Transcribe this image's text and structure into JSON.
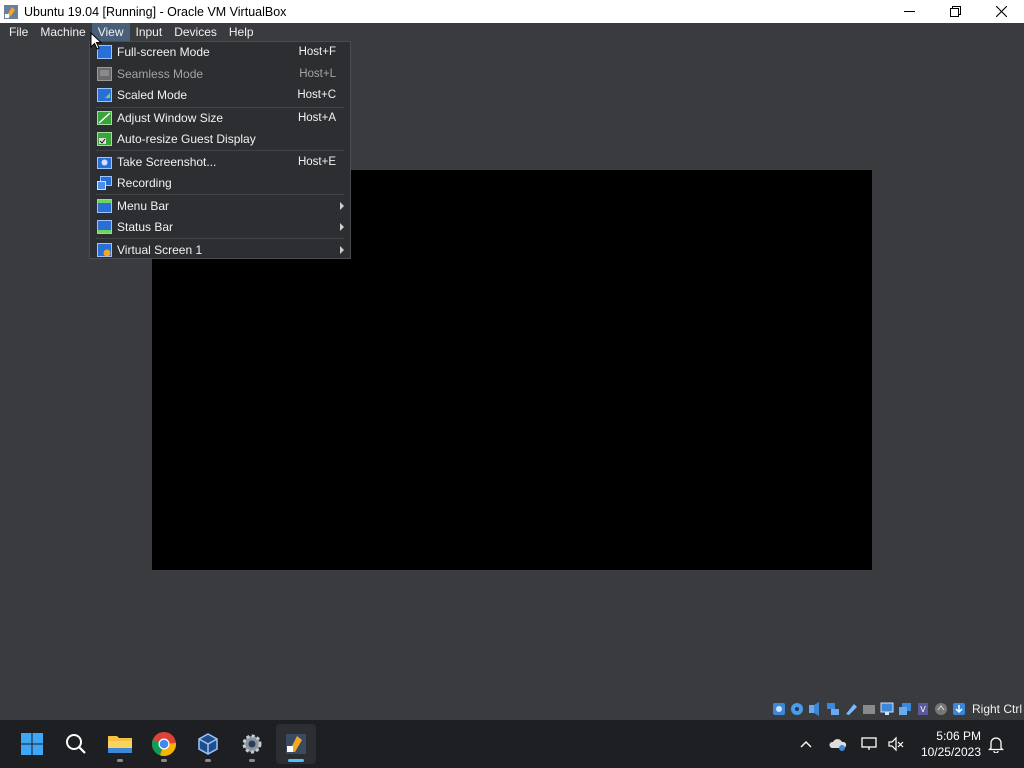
{
  "window": {
    "title": "Ubuntu 19.04 [Running] - Oracle VM VirtualBox",
    "controls": [
      "minimize-icon",
      "maximize-icon",
      "close-icon"
    ]
  },
  "menubar": {
    "items": [
      {
        "label": "File"
      },
      {
        "label": "Machine"
      },
      {
        "label": "View",
        "active": true
      },
      {
        "label": "Input"
      },
      {
        "label": "Devices"
      },
      {
        "label": "Help"
      }
    ]
  },
  "view_menu": {
    "items": [
      {
        "label": "Full-screen Mode",
        "shortcut": "Host+F",
        "icon": "fullscreen-icon"
      },
      {
        "label": "Seamless Mode",
        "shortcut": "Host+L",
        "icon": "seamless-icon",
        "disabled": true
      },
      {
        "label": "Scaled Mode",
        "shortcut": "Host+C",
        "icon": "scaled-icon"
      },
      {
        "label": "Adjust Window Size",
        "shortcut": "Host+A",
        "icon": "adjust-window-icon"
      },
      {
        "label": "Auto-resize Guest Display",
        "shortcut": "",
        "icon": "auto-resize-icon"
      },
      {
        "label": "Take Screenshot...",
        "shortcut": "Host+E",
        "icon": "screenshot-icon"
      },
      {
        "label": "Recording",
        "shortcut": "",
        "icon": "recording-icon"
      },
      {
        "label": "Menu Bar",
        "submenu": true,
        "icon": "menu-bar-icon"
      },
      {
        "label": "Status Bar",
        "submenu": true,
        "icon": "status-bar-icon"
      },
      {
        "label": "Virtual Screen 1",
        "submenu": true,
        "icon": "virtual-screen-icon"
      }
    ]
  },
  "status_bar": {
    "icons": [
      "hard-disk-icon",
      "optical-drive-icon",
      "audio-icon",
      "network-icon",
      "usb-icon",
      "shared-folders-icon",
      "display-icon",
      "recording-icon",
      "cpu-icon",
      "mouse-integration-icon",
      "keyboard-icon"
    ],
    "host_key": "Right Ctrl"
  },
  "taskbar": {
    "apps": [
      "start-icon",
      "search-icon",
      "file-explorer-icon",
      "chrome-icon",
      "virtualbox-manager-icon",
      "settings-icon",
      "virtualbox-vm-icon"
    ],
    "tray_icons": [
      "chevron-up-icon",
      "onedrive-icon",
      "network-icon",
      "volume-muted-icon"
    ],
    "time": "5:06 PM",
    "date": "10/25/2023"
  },
  "colors": {
    "background": "#3a3b3e",
    "menu_bg": "#2d2e31",
    "active_menu": "#4a5f79",
    "taskbar": "#1e1f22",
    "accent": "#4cc2ff"
  }
}
